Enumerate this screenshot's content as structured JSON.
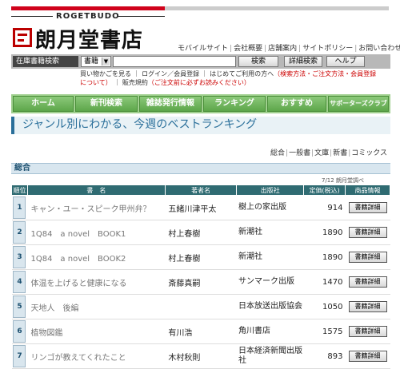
{
  "header": {
    "logo_en": "ROGETBUDO",
    "logo_jp": "朗月堂書店",
    "toplinks": [
      "モバイルサイト",
      "会社概要",
      "店舗案内",
      "サイトポリシー",
      "お問い合わせ"
    ]
  },
  "search": {
    "label": "在庫書籍検索",
    "select_value": "書籍",
    "input_value": "",
    "search_button": "検索",
    "advanced_button": "詳細検索",
    "help_button": "ヘルプ",
    "sublinks_line1": "買い物かごを見る ｜ ログイン／会員登録 ｜ はじめてご利用の方へ",
    "sublinks_line1_red": "（検索方法・ご注文方法・会員登録",
    "sublinks_line2_red": "について）",
    "sublinks_line2": "｜ 販売規約",
    "sublinks_line2_red2": "（ご注文前に必ずお読みください）"
  },
  "nav": [
    "ホーム",
    "新刊検索",
    "雑誌発行情報",
    "ランキング",
    "おすすめ",
    "サポーターズクラブ"
  ],
  "subtitle": "ジャンル別にわかる、今週のベストランキング",
  "category_links": [
    "総合",
    "一般書",
    "文庫",
    "新書",
    "コミックス"
  ],
  "section": {
    "title": "総合",
    "date_note": "7/12 朗月堂調べ"
  },
  "table": {
    "headers": [
      "順位",
      "書　名",
      "著者名",
      "出版社",
      "定価(税込)",
      "商品情報"
    ],
    "detail_label": "書籍詳細",
    "rows": [
      {
        "rank": "1",
        "title": "キャン・ユー・スピーク甲州弁？",
        "author": "五緒川津平太",
        "publisher": "樹上の家出版",
        "price": "914"
      },
      {
        "rank": "2",
        "title": "1Q84　a novel　BOOK1",
        "author": "村上春樹",
        "publisher": "新潮社",
        "price": "1890"
      },
      {
        "rank": "3",
        "title": "1Q84　a novel　BOOK2",
        "author": "村上春樹",
        "publisher": "新潮社",
        "price": "1890"
      },
      {
        "rank": "4",
        "title": "体温を上げると健康になる",
        "author": "斎藤真嗣",
        "publisher": "サンマーク出版",
        "price": "1470"
      },
      {
        "rank": "5",
        "title": "天地人　後編",
        "author": "",
        "publisher": "日本放送出版協会",
        "price": "1050"
      },
      {
        "rank": "6",
        "title": "植物図鑑",
        "author": "有川浩",
        "publisher": "角川書店",
        "price": "1575"
      },
      {
        "rank": "7",
        "title": "リンゴが教えてくれたこと",
        "author": "木村秋則",
        "publisher": "日本経済新聞出版社",
        "price": "893"
      }
    ]
  },
  "colors": {
    "brand_red": "#d0021b",
    "nav_green": "#5da64a",
    "header_teal": "#2f6b72",
    "subtitle_blue": "#2a6f9a"
  }
}
